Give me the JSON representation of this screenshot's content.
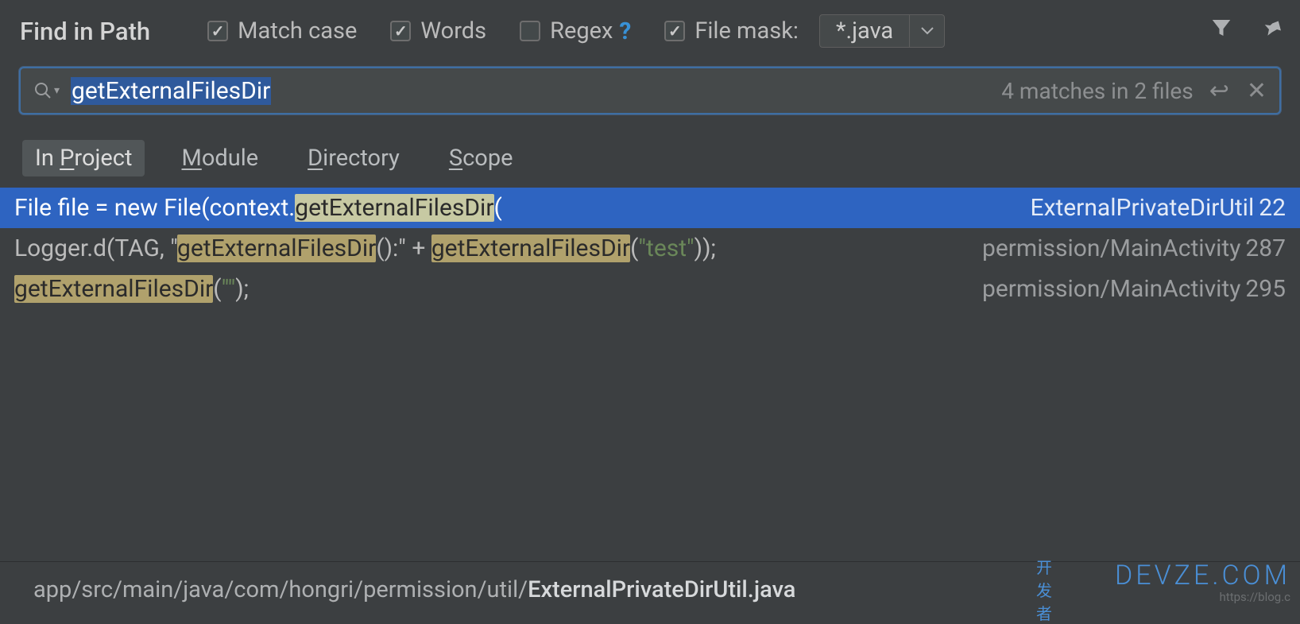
{
  "title": "Find in Path",
  "options": {
    "match_case": {
      "label": "Match case",
      "checked": true
    },
    "words": {
      "label": "Words",
      "checked": true
    },
    "regex": {
      "label": "Regex",
      "checked": false
    },
    "file_mask": {
      "label": "File mask:",
      "checked": true
    }
  },
  "file_mask_value": "*.java",
  "search": {
    "query": "getExternalFilesDir",
    "stats": "4 matches in 2 files"
  },
  "tabs": {
    "project": "In Project",
    "module": "Module",
    "directory": "Directory",
    "scope": "Scope"
  },
  "results": [
    {
      "pre": "File file = new File(context.",
      "hit": "getExternalFilesDir",
      "post": "(",
      "loc_path": "ExternalPrivateDirUtil",
      "loc_line": "22",
      "selected": true
    },
    {
      "pre": "Logger.d(TAG, \"",
      "hit": "getExternalFilesDir",
      "mid1": "():\" + ",
      "hit2": "getExternalFilesDir",
      "post": "(",
      "str": "\"test\"",
      "post2": "));",
      "loc_path": "permission/MainActivity",
      "loc_line": "287"
    },
    {
      "hit": "getExternalFilesDir",
      "post": "(",
      "str": "\"\"",
      "post2": ");",
      "loc_path": "permission/MainActivity",
      "loc_line": "295"
    }
  ],
  "status": {
    "prefix": "app/src/main/java/com/hongri/permission/util/",
    "file": "ExternalPrivateDirUtil.java"
  },
  "watermark": {
    "cn": "开 发 者",
    "main": "DEVZE.COM",
    "url": "https://blog.c"
  }
}
